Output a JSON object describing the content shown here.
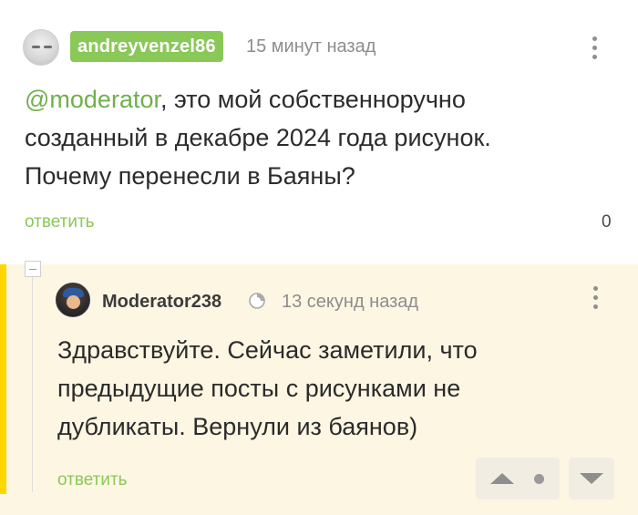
{
  "comment": {
    "author": "andreyvenzel86",
    "time": "15 минут назад",
    "mention": "@moderator",
    "text_line1_rest": ", это мой собственноручно",
    "text_line2": "созданный в декабре 2024 года рисунок.",
    "text_line3": "Почему перенесли в Баяны?",
    "reply_label": "ответить",
    "rating": "0"
  },
  "reply": {
    "author": "Moderator238",
    "time": "13 секунд назад",
    "text_line1": "Здравствуйте. Сейчас заметили, что",
    "text_line2": "предыдущие посты с рисунками не",
    "text_line3": "дубликаты. Вернули из баянов)",
    "reply_label": "ответить"
  },
  "colors": {
    "accent_green": "#8ac858",
    "highlight_bar": "#ffd600",
    "reply_background": "#fdf6e3"
  },
  "icons": [
    "more-vertical-icon",
    "moderator-icon",
    "vote-up-icon",
    "vote-down-icon",
    "collapse-icon"
  ]
}
